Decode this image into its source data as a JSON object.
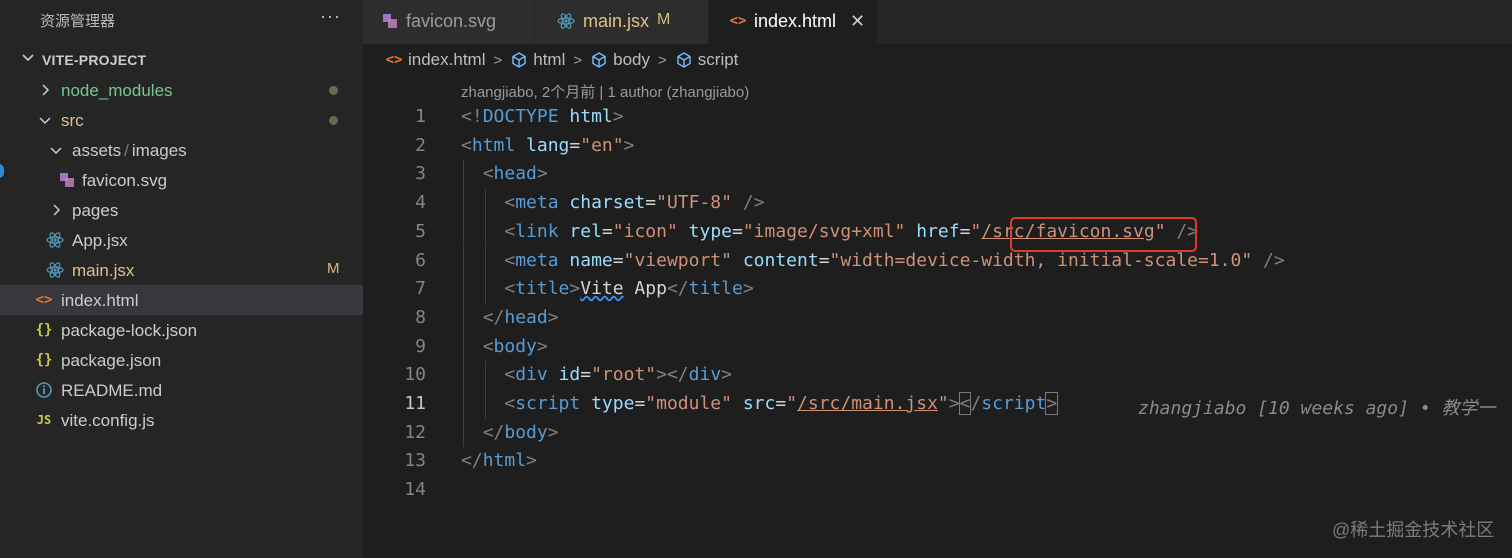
{
  "explorer": {
    "title": "资源管理器",
    "more_label": "···",
    "project_name": "VITE-PROJECT",
    "items": [
      {
        "label": "node_modules",
        "icon": "chevron-right-icon",
        "modified_dot": true
      },
      {
        "label": "src",
        "icon": "chevron-down-icon",
        "modified_dot": true
      },
      {
        "label_a": "assets",
        "label_sep": "/",
        "label_b": "images",
        "icon": "chevron-down-icon"
      },
      {
        "label": "favicon.svg",
        "icon": "svg-file-icon"
      },
      {
        "label": "pages",
        "icon": "chevron-right-icon"
      },
      {
        "label": "App.jsx",
        "icon": "react-icon"
      },
      {
        "label": "main.jsx",
        "icon": "react-icon",
        "badge": "M"
      },
      {
        "label": "index.html",
        "icon": "html-icon",
        "selected": true
      },
      {
        "label": "package-lock.json",
        "icon": "json-icon",
        "icon_text": "{}"
      },
      {
        "label": "package.json",
        "icon": "json-icon",
        "icon_text": "{}"
      },
      {
        "label": "README.md",
        "icon": "info-icon"
      },
      {
        "label": "vite.config.js",
        "icon": "js-icon",
        "icon_text": "JS"
      }
    ]
  },
  "tabs": [
    {
      "label": "favicon.svg",
      "icon": "svg-file-icon"
    },
    {
      "label": "main.jsx",
      "icon": "react-icon",
      "badge": "M"
    },
    {
      "label": "index.html",
      "icon": "html-icon",
      "active": true,
      "close": "✕"
    }
  ],
  "breadcrumb": [
    "index.html",
    "html",
    "body",
    "script"
  ],
  "codelens": "zhangjiabo, 2个月前 | 1 author (zhangjiabo)",
  "editor": {
    "line_numbers": [
      "1",
      "2",
      "3",
      "4",
      "5",
      "6",
      "7",
      "8",
      "9",
      "10",
      "11",
      "12",
      "13",
      "14"
    ],
    "current_line": "11",
    "blame": "zhangjiabo [10 weeks ago] • 教学一"
  },
  "colors": {
    "accent_highlight": "#e03a2e",
    "tag": "#569cd6",
    "attribute": "#9cdcfe",
    "string": "#ce9178"
  },
  "watermark": "@稀土掘金技术社区"
}
